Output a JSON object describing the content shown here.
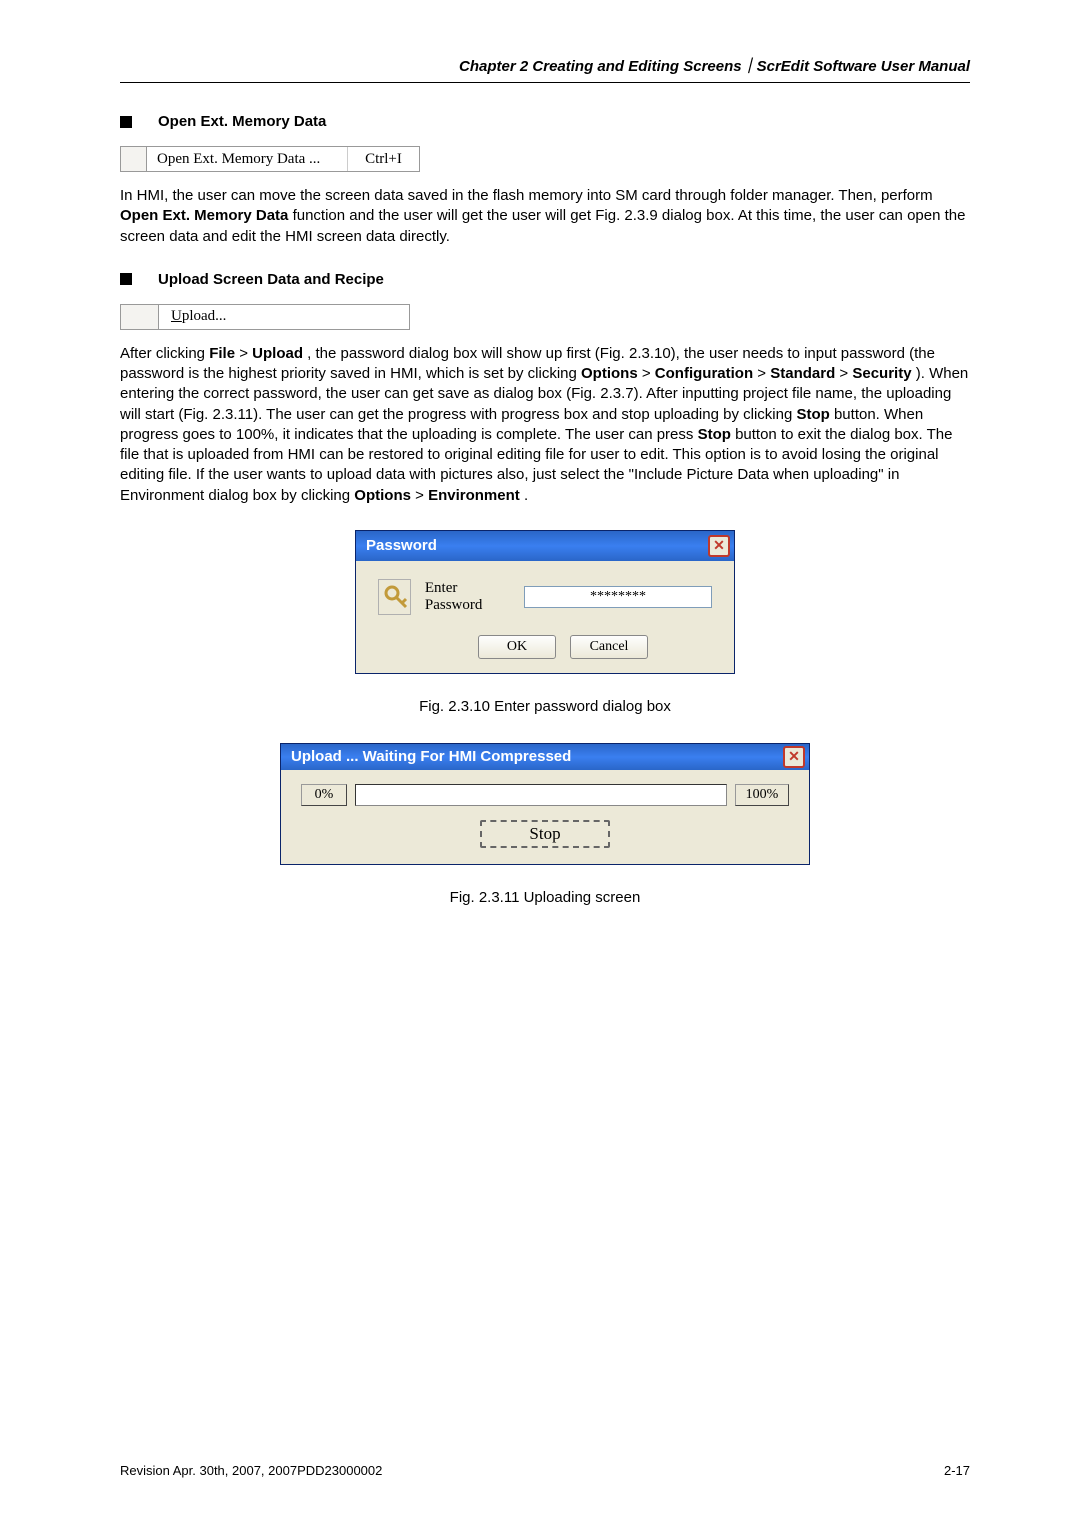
{
  "header": {
    "chapter_title": "Chapter 2  Creating and Editing Screens｜ScrEdit Software User Manual"
  },
  "sections": {
    "mem": {
      "title": "Open Ext. Memory Data",
      "menu_label": "Open Ext. Memory Data ...",
      "shortcut": "Ctrl+I",
      "para": "In HMI, the user can move the screen data saved in the flash memory into SM card through folder manager. Then, perform Open Ext. Memory Data function and the user will get the user will get Fig. 2.3.9 dialog box. At this time, the user can open the screen data and edit the HMI screen data directly.",
      "bold_phrase": "Open Ext. Memory Data"
    },
    "upl": {
      "title": "Upload Screen Data and Recipe",
      "menu_label": "Upload...",
      "para_parts": {
        "t0": "After clicking ",
        "b1": "File",
        "t1": " > ",
        "b2": "Upload",
        "t2": ", the password dialog box will show up first (Fig. 2.3.10), the user needs to input password (the password is the highest priority saved in HMI, which is set by clicking ",
        "b3": "Options",
        "t3": " > ",
        "b4": "Configuration",
        "t4": " > ",
        "b5": "Standard",
        "t5": " > ",
        "b6": "Security",
        "t6": "). When entering the correct password, the user can get save as dialog box (Fig. 2.3.7). After inputting project file name, the uploading will start (Fig. 2.3.11). The user can get the progress with progress box and stop uploading by clicking ",
        "b7": "Stop",
        "t7": " button. When progress goes to 100%, it indicates that the uploading is complete. The user can press ",
        "b8": "Stop",
        "t8": " button to exit the dialog box. The file that is uploaded from HMI can be restored to original editing file for user to edit. This option is to avoid losing the original editing file. If the user wants to upload data with pictures also, just select the \"Include Picture Data when uploading\" in Environment dialog box by clicking ",
        "b9": "Options",
        "t9": " > ",
        "b10": "Environment",
        "t10": "."
      }
    }
  },
  "password_dialog": {
    "title": "Password",
    "label": "Enter Password",
    "value": "********",
    "ok_label": "OK",
    "cancel_label": "Cancel",
    "caption": "Fig. 2.3.10 Enter password dialog box"
  },
  "upload_dialog": {
    "title": "Upload ...  Waiting For HMI Compressed",
    "left_pct": "0%",
    "right_pct": "100%",
    "stop_label": "Stop",
    "caption": "Fig. 2.3.11 Uploading screen"
  },
  "footer": {
    "revision": "Revision Apr. 30th, 2007, 2007PDD23000002",
    "page": "2-17"
  }
}
